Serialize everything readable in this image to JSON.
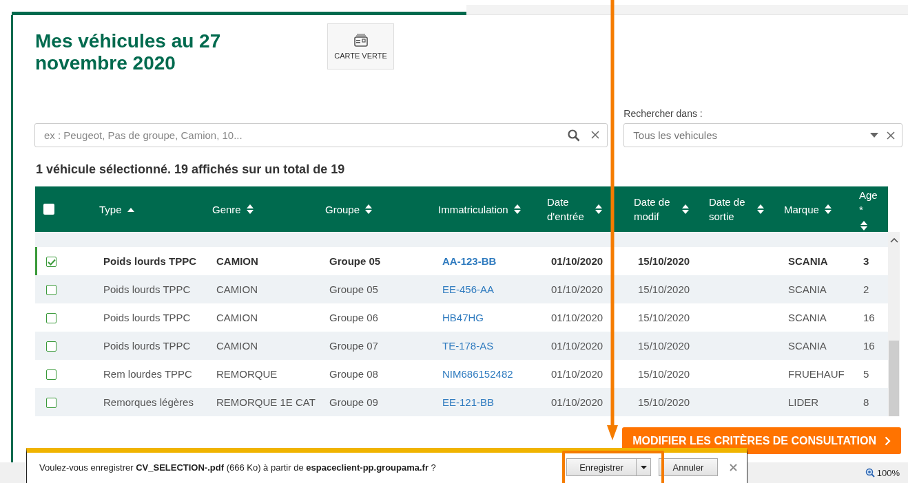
{
  "page": {
    "title": "Mes véhicules au 27 novembre 2020",
    "actions": [
      {
        "label": "CARTE VERTE"
      }
    ]
  },
  "search": {
    "placeholder": "ex : Peugeot, Pas de groupe, Camion, 10..."
  },
  "scope": {
    "label": "Rechercher dans :",
    "value": "Tous les vehicules"
  },
  "summary": "1 véhicule sélectionné. 19 affichés sur un total de 19",
  "table": {
    "select_all": {
      "checked": false
    },
    "columns": [
      {
        "label": "Type",
        "sorted": true
      },
      {
        "label": "Genre",
        "sorted": false
      },
      {
        "label": "Groupe",
        "sorted": false
      },
      {
        "label": "Immatriculation",
        "sorted": false,
        "link": true
      },
      {
        "label": "Date d'entrée",
        "sorted": false
      },
      {
        "label": "Date de modif",
        "sorted": false
      },
      {
        "label": "Date de sortie",
        "sorted": false
      },
      {
        "label": "Marque",
        "sorted": false
      },
      {
        "label": "Age *",
        "sorted": false
      }
    ],
    "rows": [
      {
        "selected": true,
        "cells": [
          "Poids lourds TPPC",
          "CAMION",
          "Groupe 05",
          "AA-123-BB",
          "01/10/2020",
          "15/10/2020",
          "",
          "SCANIA",
          "3"
        ]
      },
      {
        "selected": false,
        "cells": [
          "Poids lourds TPPC",
          "CAMION",
          "Groupe 05",
          "EE-456-AA",
          "01/10/2020",
          "15/10/2020",
          "",
          "SCANIA",
          "2"
        ]
      },
      {
        "selected": false,
        "cells": [
          "Poids lourds TPPC",
          "CAMION",
          "Groupe 06",
          "HB47HG",
          "01/10/2020",
          "15/10/2020",
          "",
          "SCANIA",
          "16"
        ]
      },
      {
        "selected": false,
        "cells": [
          "Poids lourds TPPC",
          "CAMION",
          "Groupe 07",
          "TE-178-AS",
          "01/10/2020",
          "15/10/2020",
          "",
          "SCANIA",
          "16"
        ]
      },
      {
        "selected": false,
        "cells": [
          "Rem lourdes TPPC",
          "REMORQUE",
          "Groupe 08",
          "NIM686152482",
          "01/10/2020",
          "15/10/2020",
          "",
          "FRUEHAUF",
          "5"
        ]
      },
      {
        "selected": false,
        "cells": [
          "Remorques légères",
          "REMORQUE 1E CAT",
          "Groupe 09",
          "EE-121-BB",
          "01/10/2020",
          "15/10/2020",
          "",
          "LIDER",
          "8"
        ]
      }
    ]
  },
  "footer_button": {
    "label": "MODIFIER LES CRITÈRES DE CONSULTATION"
  },
  "download_bar": {
    "message": "Voulez-vous enregistrer **CV_SELECTION-.pdf** (666 Ko) à partir de **espaceclient-pp.groupama.fr** ?",
    "buttons": [
      {
        "label": "Enregistrer",
        "kind": "split"
      },
      {
        "label": "Annuler",
        "kind": "plain"
      }
    ]
  },
  "status_bar": {
    "zoom": "100%"
  }
}
